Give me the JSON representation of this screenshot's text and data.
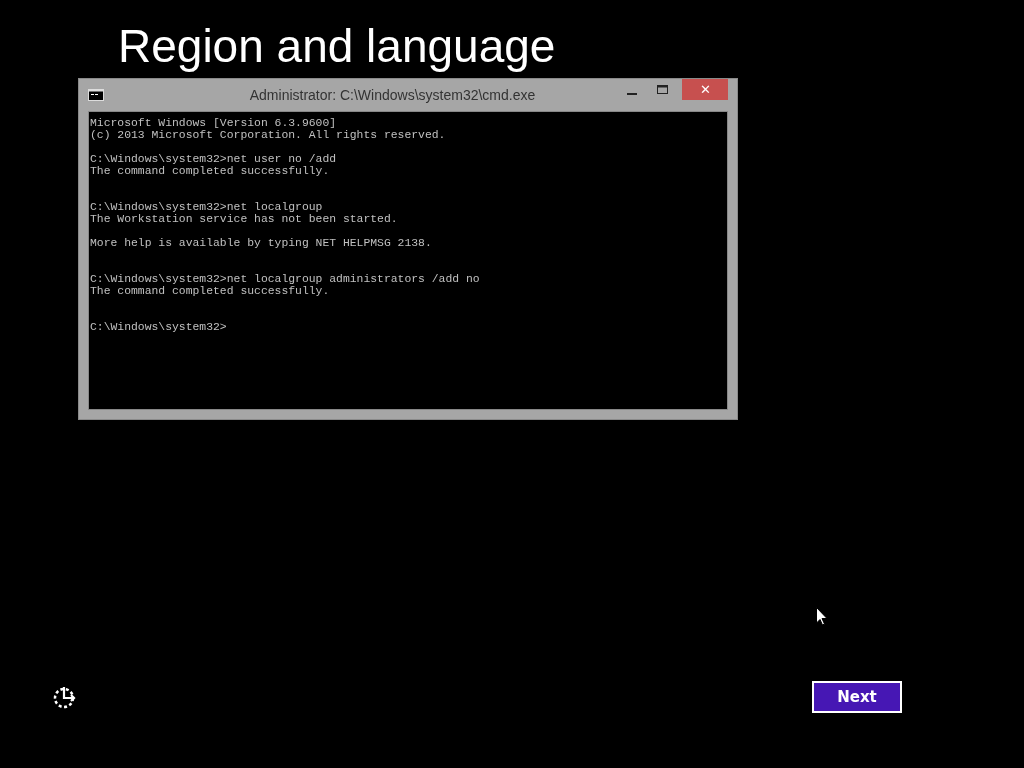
{
  "heading": "Region and language",
  "console_window": {
    "title": "Administrator: C:\\Windows\\system32\\cmd.exe",
    "close": "✕",
    "text": "Microsoft Windows [Version 6.3.9600]\n(c) 2013 Microsoft Corporation. All rights reserved.\n\nC:\\Windows\\system32>net user no /add\nThe command completed successfully.\n\n\nC:\\Windows\\system32>net localgroup\nThe Workstation service has not been started.\n\nMore help is available by typing NET HELPMSG 2138.\n\n\nC:\\Windows\\system32>net localgroup administrators /add no\nThe command completed successfully.\n\n\nC:\\Windows\\system32>"
  },
  "next_button": "Next"
}
